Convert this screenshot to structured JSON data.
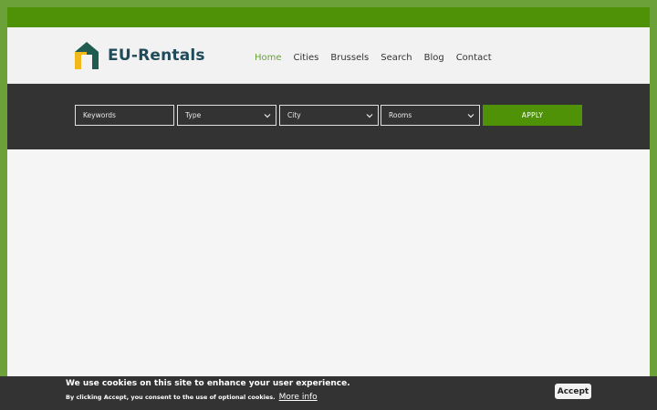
{
  "brand": {
    "name": "EU-Rentals",
    "colors": {
      "accent": "#4f9208",
      "frame": "#6ca13a",
      "dark": "#333333",
      "logo_text": "#1f4a5a",
      "nav_active": "#6aa036"
    }
  },
  "nav": {
    "items": [
      {
        "label": "Home",
        "active": true
      },
      {
        "label": "Cities",
        "active": false
      },
      {
        "label": "Brussels",
        "active": false
      },
      {
        "label": "Search",
        "active": false
      },
      {
        "label": "Blog",
        "active": false
      },
      {
        "label": "Contact",
        "active": false
      }
    ]
  },
  "search": {
    "keywords_placeholder": "Keywords",
    "type_value": "Type",
    "city_value": "City",
    "rooms_value": "Rooms",
    "apply_label": "APPLY"
  },
  "cookie": {
    "title": "We use cookies on this site to enhance your user experience.",
    "consent_text": "By clicking Accept, you consent to the use of optional cookies.",
    "more_info": "More info",
    "accept_label": "Accept"
  }
}
